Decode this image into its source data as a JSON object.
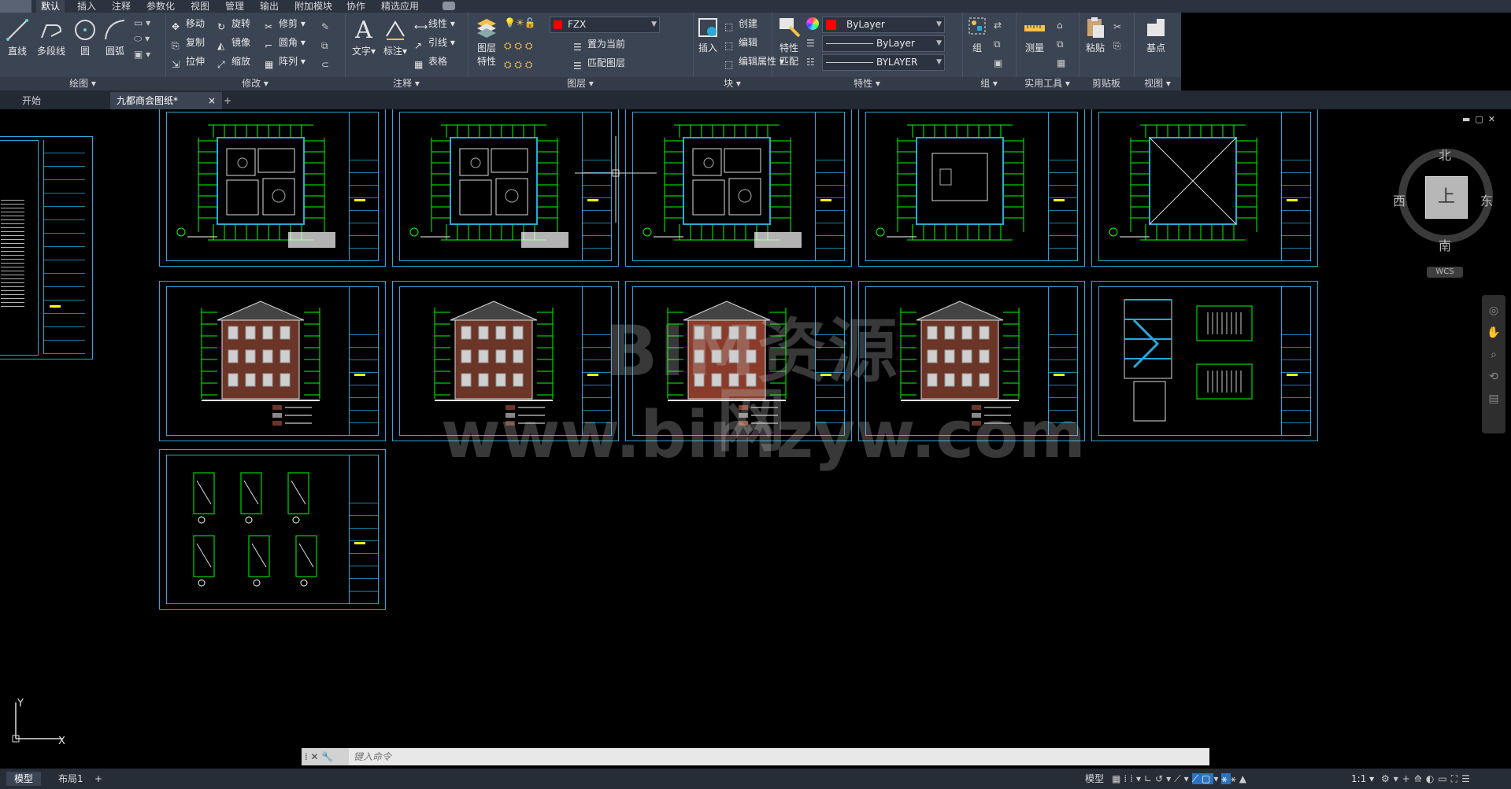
{
  "menu": {
    "tabs": [
      "默认",
      "插入",
      "注释",
      "参数化",
      "视图",
      "管理",
      "输出",
      "附加模块",
      "协作",
      "精选应用"
    ]
  },
  "ribbon": {
    "draw": {
      "title": "绘图",
      "line": "直线",
      "polyline": "多段线",
      "circle": "圆",
      "arc": "圆弧"
    },
    "modify": {
      "title": "修改",
      "move": "移动",
      "rotate": "旋转",
      "trim": "修剪",
      "copy": "复制",
      "mirror": "镜像",
      "fillet": "圆角",
      "stretch": "拉伸",
      "scale": "缩放",
      "array": "阵列"
    },
    "annotation": {
      "title": "注释",
      "text": "文字",
      "dimension": "标注",
      "linear": "线性",
      "leader": "引线",
      "table": "表格"
    },
    "layers": {
      "title": "图层",
      "properties_line1": "图层",
      "properties_line2": "特性",
      "current_layer": "FZX",
      "set_current": "置为当前",
      "match_layer": "匹配图层"
    },
    "block": {
      "title": "块",
      "insert": "插入",
      "create": "创建",
      "edit": "编辑",
      "edit_attributes": "编辑属性"
    },
    "properties": {
      "title": "特性",
      "match_line1": "特性",
      "match_line2": "匹配",
      "color": "ByLayer",
      "linetype": "ByLayer",
      "lineweight": "BYLAYER"
    },
    "groups": {
      "title": "组",
      "group": "组"
    },
    "utilities": {
      "title": "实用工具",
      "measure": "测量"
    },
    "clipboard": {
      "title": "剪贴板",
      "paste": "粘贴"
    },
    "view": {
      "title": "视图",
      "base": "基点"
    }
  },
  "doc_tabs": {
    "start": "开始",
    "file": "九都商会图纸*",
    "close": "×",
    "new": "+"
  },
  "viewcube": {
    "north": "北",
    "south": "南",
    "east": "东",
    "west": "西",
    "top": "上",
    "wcs": "WCS"
  },
  "watermark": {
    "line1": "BIM资源网",
    "line2": "www.bimzyw.com"
  },
  "ucs": {
    "x": "X",
    "y": "Y"
  },
  "command": {
    "placeholder": "键入命令"
  },
  "status": {
    "model_tab": "模型",
    "layout_tab": "布局1",
    "add": "+",
    "mode": "模型",
    "scale": "1:1"
  },
  "colors": {
    "accent": "#2ba7d9",
    "ribbon_bg": "#3b4453",
    "canvas": "#000000",
    "drawing_green": "#00ff00",
    "layer_red": "#ff0000"
  }
}
